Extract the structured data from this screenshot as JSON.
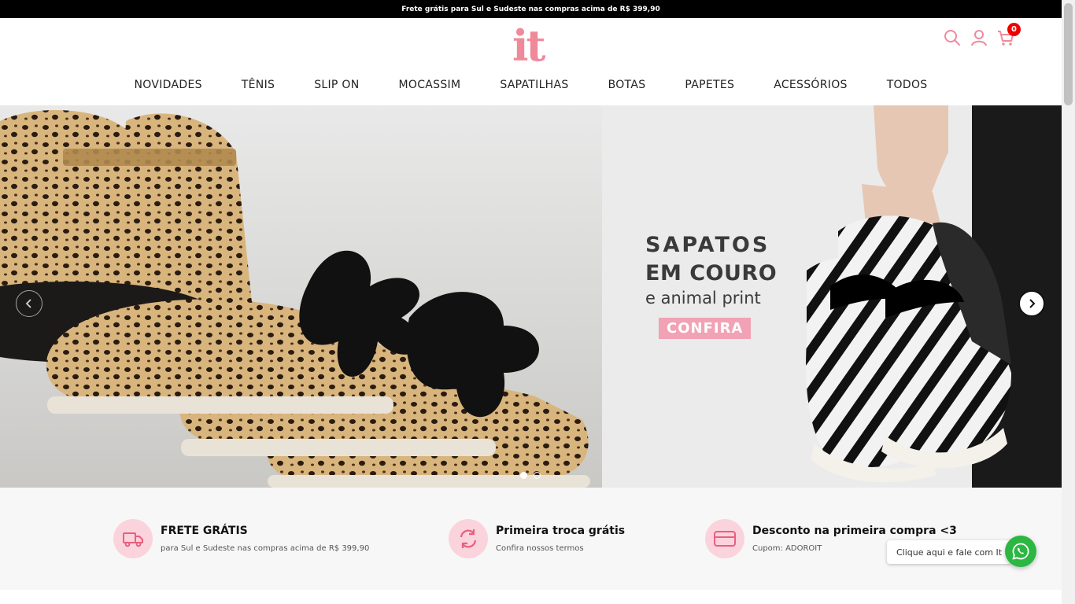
{
  "announcement": "Frete grátis para Sul e Sudeste nas compras acima de R$ 399,90",
  "brand": {
    "logo": "it",
    "color": "#ef8a9b"
  },
  "header_icons": [
    {
      "name": "search-icon"
    },
    {
      "name": "user-icon"
    },
    {
      "name": "cart-icon",
      "count": "0"
    }
  ],
  "nav": [
    "NOVIDADES",
    "TÊNIS",
    "SLIP ON",
    "MOCASSIM",
    "SAPATILHAS",
    "BOTAS",
    "PAPETES",
    "ACESSÓRIOS",
    "TODOS"
  ],
  "hero": {
    "line1": "SAPATOS",
    "line2": "EM COURO",
    "line3": "e animal print",
    "cta": "CONFIRA",
    "cta_color": "#f2a2b5",
    "slides": 2,
    "active_slide": 1
  },
  "features": [
    {
      "icon": "truck-icon",
      "title": "FRETE GRÁTIS",
      "subtitle": "para Sul e Sudeste nas compras acima de R$ 399,90"
    },
    {
      "icon": "refresh-icon",
      "title": "Primeira troca grátis",
      "subtitle": "Confira nossos termos"
    },
    {
      "icon": "credit-card-icon",
      "title": "Desconto na primeira compra <3",
      "subtitle": "Cupom: ADOROIT"
    }
  ],
  "whatsapp": {
    "label": "Clique aqui e fale com It",
    "color": "#2cb742"
  }
}
